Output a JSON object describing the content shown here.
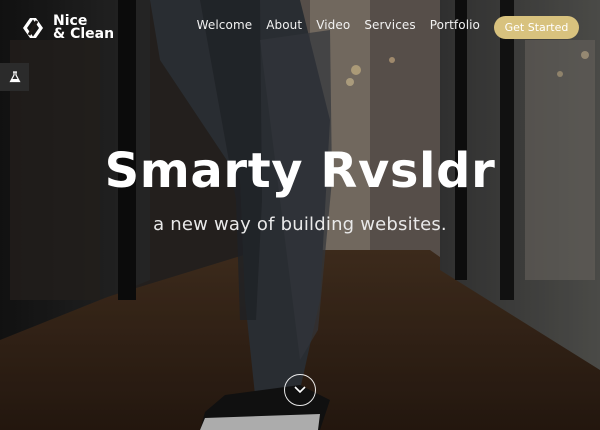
{
  "logo": {
    "line1": "Nice",
    "line2": "& Clean"
  },
  "nav": {
    "items": [
      {
        "label": "Welcome"
      },
      {
        "label": "About"
      },
      {
        "label": "Video"
      },
      {
        "label": "Services"
      },
      {
        "label": "Portfolio"
      }
    ],
    "cta_label": "Get Started"
  },
  "hero": {
    "title": "Smarty Rvsldr",
    "subtitle": "a new way of building websites."
  },
  "icons": {
    "logo": "logo-mark-icon",
    "side_tab": "flask-icon",
    "scroll": "chevron-down-icon"
  },
  "colors": {
    "accent": "#d8c27e",
    "text": "#ffffff",
    "side_tab_bg": "#2b2b2b"
  }
}
